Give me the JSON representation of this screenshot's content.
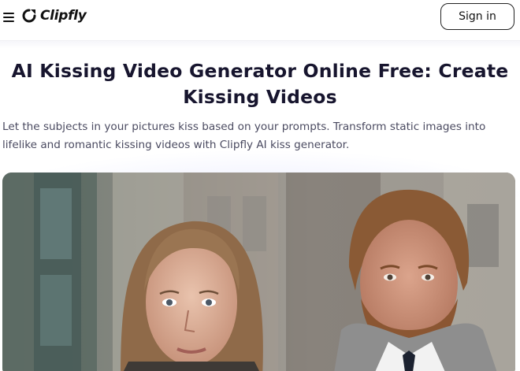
{
  "header": {
    "menu_icon": "hamburger-menu-icon",
    "logo_icon": "clipfly-logo-icon",
    "logo_text": "Clipfly",
    "signin_label": "Sign in"
  },
  "hero": {
    "title": "AI Kissing Video Generator Online Free: Create Kissing Videos",
    "description": "Let the subjects in your pictures kiss based on your prompts. Transform static images into lifelike and romantic kissing videos with Clipfly AI kiss generator."
  },
  "colors": {
    "title": "#17152e",
    "text": "#4a4a60",
    "accent": "#111111"
  }
}
